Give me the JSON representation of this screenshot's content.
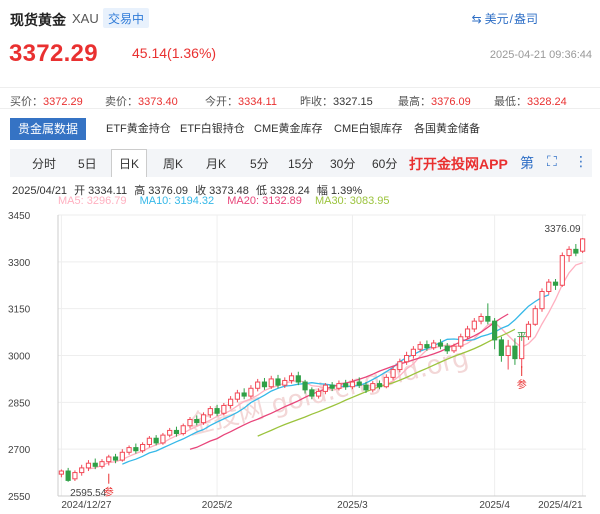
{
  "header": {
    "title": "现货黄金",
    "symbol": "XAU",
    "status": "交易中",
    "currency": "美元",
    "unit": "盎司"
  },
  "quote": {
    "price": "3372.29",
    "change": "45.14(1.36%)",
    "datetime": "2025-04-21 09:36:44"
  },
  "stats": [
    {
      "label": "买价：",
      "value": "3372.29",
      "color": "red"
    },
    {
      "label": "卖价：",
      "value": "3373.40",
      "color": "red"
    },
    {
      "label": "今开：",
      "value": "3334.11",
      "color": "red"
    },
    {
      "label": "昨收：",
      "value": "3327.15",
      "color": "neutral"
    },
    {
      "label": "最高：",
      "value": "3376.09",
      "color": "red"
    },
    {
      "label": "最低：",
      "value": "3328.24",
      "color": "red"
    }
  ],
  "tabs": [
    "贵金属数据",
    "ETF黄金持仓",
    "ETF白银持仓",
    "CME黄金库存",
    "CME白银库存",
    "各国黄金储备"
  ],
  "periods": [
    "分时",
    "5日",
    "日K",
    "周K",
    "月K",
    "5分",
    "15分",
    "30分",
    "60分"
  ],
  "active_period": "日K",
  "app_link": "打开金投网APP",
  "tools": {
    "drawing": "第",
    "fullscreen": "⛶",
    "more": "⋮"
  },
  "ohlc": {
    "date": "2025/04/21",
    "open": "开 3334.11",
    "high": "高 3376.09",
    "close": "收 3373.48",
    "low": "低 3328.24",
    "pct": "幅 1.39%"
  },
  "ma": [
    {
      "label": "MA5: 3296.79",
      "color": "#ffb0c0"
    },
    {
      "label": "MA10: 3194.32",
      "color": "#35b8e8"
    },
    {
      "label": "MA20: 3132.89",
      "color": "#e8457a"
    },
    {
      "label": "MA30: 3083.95",
      "color": "#9bc33c"
    }
  ],
  "watermark": "金投网 gold.cngold.org",
  "chart_data": {
    "type": "candlestick",
    "ylim": [
      2550,
      3450
    ],
    "yticks": [
      2550,
      2700,
      2850,
      3000,
      3150,
      3300,
      3450
    ],
    "xticks": [
      {
        "label": "2024/12/27",
        "index": 0
      },
      {
        "label": "2025/2",
        "index": 23
      },
      {
        "label": "2025/3",
        "index": 43
      },
      {
        "label": "2025/4",
        "index": 64
      },
      {
        "label": "2025/4/21",
        "index": 77
      }
    ],
    "annotations": [
      {
        "label": "3376.09",
        "index": 77,
        "value": 3376.09,
        "kind": "high"
      },
      {
        "label": "2595.54",
        "index": 1,
        "value": 2595.54,
        "kind": "low"
      }
    ],
    "markers": [
      {
        "label": "参",
        "index": 7,
        "value": 2615
      },
      {
        "label": "参",
        "index": 68,
        "value": 2960
      },
      {
        "label": "平",
        "index": 68,
        "value": 3050
      }
    ],
    "candles": [
      [
        2620,
        2630,
        2635,
        2610
      ],
      [
        2630,
        2600,
        2640,
        2595.54
      ],
      [
        2605,
        2625,
        2632,
        2598
      ],
      [
        2625,
        2640,
        2650,
        2615
      ],
      [
        2640,
        2655,
        2665,
        2630
      ],
      [
        2655,
        2645,
        2670,
        2636
      ],
      [
        2645,
        2660,
        2668,
        2638
      ],
      [
        2660,
        2675,
        2682,
        2648
      ],
      [
        2675,
        2665,
        2685,
        2655
      ],
      [
        2665,
        2690,
        2700,
        2660
      ],
      [
        2690,
        2705,
        2712,
        2682
      ],
      [
        2705,
        2695,
        2718,
        2686
      ],
      [
        2695,
        2715,
        2722,
        2688
      ],
      [
        2715,
        2735,
        2742,
        2706
      ],
      [
        2735,
        2720,
        2745,
        2712
      ],
      [
        2720,
        2745,
        2752,
        2714
      ],
      [
        2745,
        2760,
        2768,
        2738
      ],
      [
        2760,
        2750,
        2772,
        2740
      ],
      [
        2750,
        2775,
        2782,
        2744
      ],
      [
        2775,
        2795,
        2803,
        2766
      ],
      [
        2795,
        2785,
        2808,
        2776
      ],
      [
        2785,
        2810,
        2818,
        2778
      ],
      [
        2810,
        2830,
        2838,
        2800
      ],
      [
        2830,
        2815,
        2842,
        2806
      ],
      [
        2815,
        2840,
        2848,
        2808
      ],
      [
        2840,
        2860,
        2870,
        2830
      ],
      [
        2860,
        2880,
        2890,
        2850
      ],
      [
        2880,
        2870,
        2895,
        2860
      ],
      [
        2870,
        2895,
        2905,
        2862
      ],
      [
        2895,
        2915,
        2925,
        2885
      ],
      [
        2915,
        2900,
        2928,
        2890
      ],
      [
        2900,
        2925,
        2935,
        2893
      ],
      [
        2925,
        2905,
        2938,
        2895
      ],
      [
        2905,
        2920,
        2930,
        2896
      ],
      [
        2920,
        2935,
        2945,
        2910
      ],
      [
        2935,
        2915,
        2948,
        2905
      ],
      [
        2915,
        2890,
        2922,
        2878
      ],
      [
        2890,
        2870,
        2898,
        2860
      ],
      [
        2870,
        2885,
        2895,
        2862
      ],
      [
        2885,
        2905,
        2912,
        2876
      ],
      [
        2905,
        2895,
        2915,
        2886
      ],
      [
        2895,
        2910,
        2920,
        2888
      ],
      [
        2910,
        2900,
        2922,
        2890
      ],
      [
        2900,
        2915,
        2925,
        2892
      ],
      [
        2915,
        2905,
        2930,
        2896
      ],
      [
        2905,
        2890,
        2915,
        2880
      ],
      [
        2890,
        2910,
        2918,
        2882
      ],
      [
        2910,
        2900,
        2920,
        2892
      ],
      [
        2900,
        2930,
        2940,
        2895
      ],
      [
        2930,
        2955,
        2965,
        2922
      ],
      [
        2955,
        2980,
        2990,
        2946
      ],
      [
        2980,
        3000,
        3012,
        2970
      ],
      [
        3000,
        3020,
        3030,
        2990
      ],
      [
        3020,
        3035,
        3045,
        3010
      ],
      [
        3035,
        3025,
        3048,
        3015
      ],
      [
        3025,
        3040,
        3050,
        3018
      ],
      [
        3040,
        3030,
        3052,
        3020
      ],
      [
        3030,
        3015,
        3040,
        3005
      ],
      [
        3015,
        3030,
        3038,
        3008
      ],
      [
        3030,
        3060,
        3070,
        3022
      ],
      [
        3060,
        3085,
        3095,
        3052
      ],
      [
        3085,
        3110,
        3120,
        3075
      ],
      [
        3110,
        3125,
        3135,
        3100
      ],
      [
        3125,
        3110,
        3167,
        3100
      ],
      [
        3110,
        3050,
        3120,
        3020
      ],
      [
        3050,
        3000,
        3060,
        2980
      ],
      [
        3000,
        3030,
        3050,
        2955
      ],
      [
        3030,
        2990,
        3055,
        2970
      ],
      [
        2990,
        3060,
        3075,
        2960
      ],
      [
        3060,
        3100,
        3110,
        3050
      ],
      [
        3100,
        3150,
        3160,
        3095
      ],
      [
        3150,
        3205,
        3215,
        3140
      ],
      [
        3205,
        3235,
        3245,
        3195
      ],
      [
        3235,
        3225,
        3245,
        3210
      ],
      [
        3225,
        3320,
        3330,
        3220
      ],
      [
        3320,
        3340,
        3350,
        3300
      ],
      [
        3340,
        3328,
        3357,
        3318
      ],
      [
        3334.11,
        3373.48,
        3376.09,
        3328.24
      ]
    ],
    "series": [
      {
        "name": "MA5",
        "color": "#ffb0c0",
        "start": 4,
        "values": [
          2637,
          2640,
          2648,
          2657,
          2660,
          2667,
          2677,
          2686,
          2694,
          2705,
          2714,
          2720,
          2733,
          2743,
          2751,
          2763,
          2773,
          2783,
          2793,
          2805,
          2813,
          2824,
          2839,
          2853,
          2861,
          2873,
          2888,
          2897,
          2903,
          2913,
          2916,
          2920,
          2914,
          2903,
          2901,
          2893,
          2889,
          2893,
          2901,
          2903,
          2906,
          2904,
          2904,
          2905,
          2907,
          2919,
          2935,
          2957,
          2973,
          2998,
          3018,
          3024,
          3029,
          3034,
          3030,
          3030,
          3039,
          3054,
          3076,
          3098,
          3106,
          3086,
          3064,
          3043,
          3026,
          3038,
          3060,
          3101,
          3138,
          3179,
          3227,
          3265,
          3290,
          3297
        ]
      },
      {
        "name": "MA10",
        "color": "#35b8e8",
        "start": 9,
        "values": [
          2652,
          2661,
          2668,
          2677,
          2688,
          2694,
          2704,
          2714,
          2724,
          2733,
          2744,
          2755,
          2763,
          2776,
          2787,
          2797,
          2807,
          2818,
          2832,
          2849,
          2861,
          2873,
          2886,
          2895,
          2902,
          2904,
          2908,
          2910,
          2913,
          2910,
          2908,
          2905,
          2903,
          2900,
          2902,
          2904,
          2912,
          2923,
          2935,
          2948,
          2962,
          2980,
          2994,
          3003,
          3014,
          3022,
          3031,
          3042,
          3052,
          3053,
          3051,
          3048,
          3051,
          3061,
          3067,
          3075,
          3087,
          3096,
          3114,
          3136,
          3158,
          3173,
          3186,
          3194
        ]
      },
      {
        "name": "MA20",
        "color": "#e8457a",
        "start": 19,
        "values": [
          2700,
          2706,
          2716,
          2726,
          2734,
          2746,
          2756,
          2767,
          2778,
          2788,
          2796,
          2806,
          2815,
          2825,
          2836,
          2845,
          2855,
          2866,
          2876,
          2884,
          2893,
          2900,
          2906,
          2912,
          2917,
          2924,
          2931,
          2940,
          2950,
          2958,
          2966,
          2973,
          2979,
          2986,
          2993,
          2998,
          3005,
          3013,
          3023,
          3034,
          3044,
          3053,
          3063,
          3075,
          3090,
          3106,
          3120,
          3133
        ]
      },
      {
        "name": "MA30",
        "color": "#9bc33c",
        "start": 29,
        "values": [
          2742,
          2751,
          2760,
          2770,
          2779,
          2787,
          2795,
          2803,
          2812,
          2820,
          2829,
          2838,
          2847,
          2857,
          2866,
          2875,
          2884,
          2892,
          2900,
          2906,
          2913,
          2921,
          2930,
          2940,
          2950,
          2959,
          2969,
          2979,
          2988,
          2997,
          3005,
          3013,
          3022,
          3032,
          3043,
          3054,
          3063,
          3073,
          3084
        ]
      }
    ]
  }
}
